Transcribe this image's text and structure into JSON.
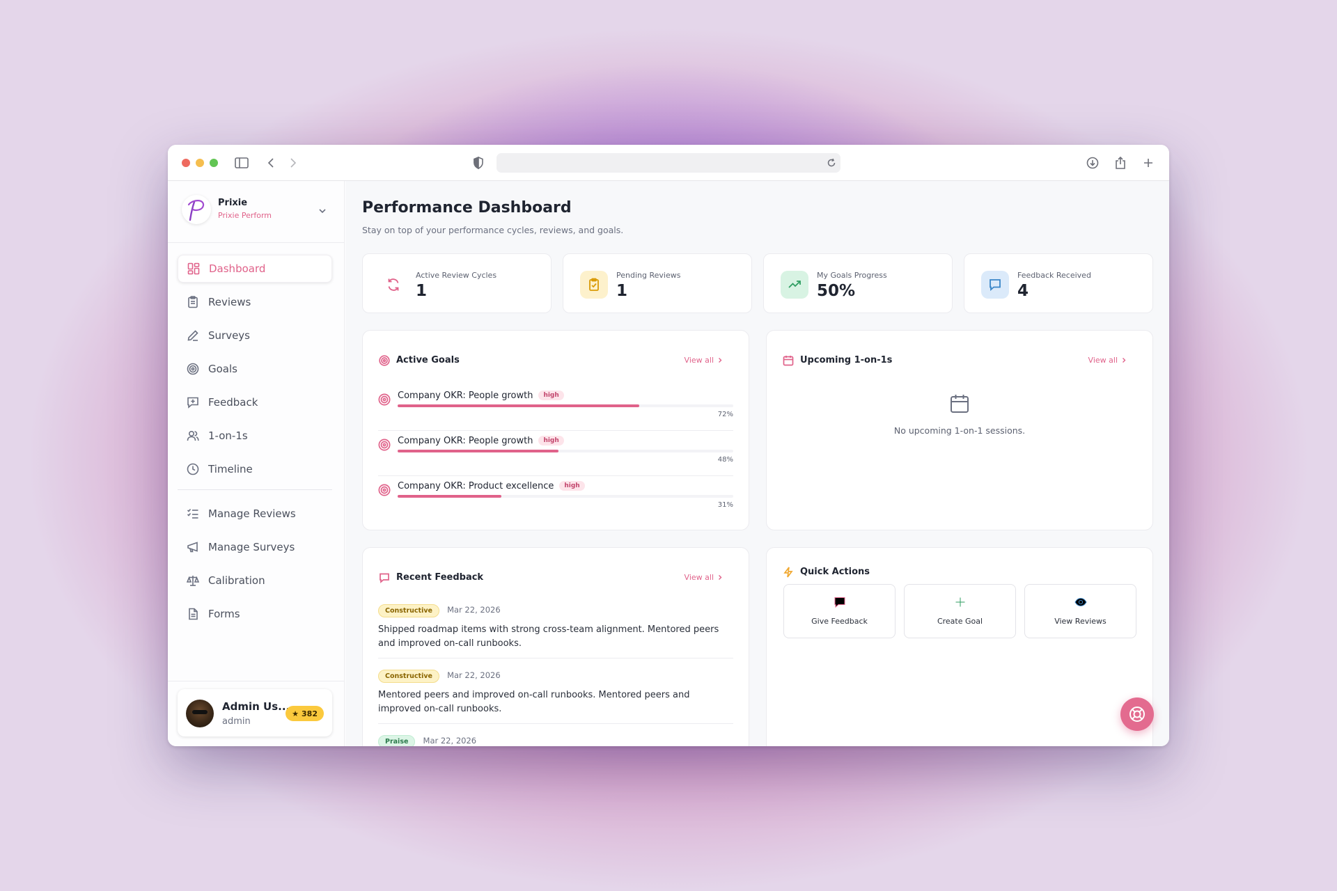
{
  "browser": {
    "url": ""
  },
  "brand": {
    "name": "Prixie",
    "subtitle": "Prixie Perform"
  },
  "nav": {
    "items": [
      {
        "label": "Dashboard",
        "icon": "grid-icon",
        "active": true
      },
      {
        "label": "Reviews",
        "icon": "clipboard-icon"
      },
      {
        "label": "Surveys",
        "icon": "pen-icon"
      },
      {
        "label": "Goals",
        "icon": "target-icon"
      },
      {
        "label": "Feedback",
        "icon": "message-plus-icon"
      },
      {
        "label": "1-on-1s",
        "icon": "users-icon"
      },
      {
        "label": "Timeline",
        "icon": "clock-icon"
      }
    ],
    "admin_items": [
      {
        "label": "Manage Reviews",
        "icon": "list-checks-icon"
      },
      {
        "label": "Manage Surveys",
        "icon": "megaphone-icon"
      },
      {
        "label": "Calibration",
        "icon": "scale-icon"
      },
      {
        "label": "Forms",
        "icon": "file-icon"
      }
    ]
  },
  "user": {
    "name": "Admin Us...",
    "role": "admin",
    "points": "382"
  },
  "page": {
    "title": "Performance Dashboard",
    "subtitle": "Stay on top of your performance cycles, reviews, and goals."
  },
  "stats": [
    {
      "label": "Active Review Cycles",
      "value": "1",
      "icon": "refresh-icon",
      "color": "#e0628a",
      "bg": "#ffffff"
    },
    {
      "label": "Pending Reviews",
      "value": "1",
      "icon": "clipboard-check-icon",
      "color": "#d99a06",
      "bg": "#fdf1cc"
    },
    {
      "label": "My Goals Progress",
      "value": "50%",
      "icon": "trending-up-icon",
      "color": "#2f9e62",
      "bg": "#d8f3e3"
    },
    {
      "label": "Feedback Received",
      "value": "4",
      "icon": "message-icon",
      "color": "#3a86c8",
      "bg": "#dbeafa"
    }
  ],
  "active_goals": {
    "title": "Active Goals",
    "view_all": "View all",
    "items": [
      {
        "name": "Company OKR: People growth",
        "priority": "high",
        "progress": 72,
        "progress_label": "72%"
      },
      {
        "name": "Company OKR: People growth",
        "priority": "high",
        "progress": 48,
        "progress_label": "48%"
      },
      {
        "name": "Company OKR: Product excellence",
        "priority": "high",
        "progress": 31,
        "progress_label": "31%"
      }
    ]
  },
  "upcoming": {
    "title": "Upcoming 1-on-1s",
    "view_all": "View all",
    "empty": "No upcoming 1-on-1 sessions."
  },
  "recent_feedback": {
    "title": "Recent Feedback",
    "view_all": "View all",
    "items": [
      {
        "type": "Constructive",
        "date": "Mar 22, 2026",
        "text": "Shipped roadmap items with strong cross-team alignment. Mentored peers and improved on-call runbooks."
      },
      {
        "type": "Constructive",
        "date": "Mar 22, 2026",
        "text": "Mentored peers and improved on-call runbooks. Mentored peers and improved on-call runbooks."
      },
      {
        "type": "Praise",
        "date": "Mar 22, 2026",
        "text": ""
      }
    ]
  },
  "quick_actions": {
    "title": "Quick Actions",
    "buttons": [
      {
        "label": "Give Feedback",
        "icon": "message-icon",
        "color": "#e0628a"
      },
      {
        "label": "Create Goal",
        "icon": "plus-icon",
        "color": "#2f9e62"
      },
      {
        "label": "View Reviews",
        "icon": "eye-icon",
        "color": "#3a86c8"
      }
    ]
  },
  "colors": {
    "accent": "#e0628a",
    "points_badge": "#fbc93d"
  }
}
